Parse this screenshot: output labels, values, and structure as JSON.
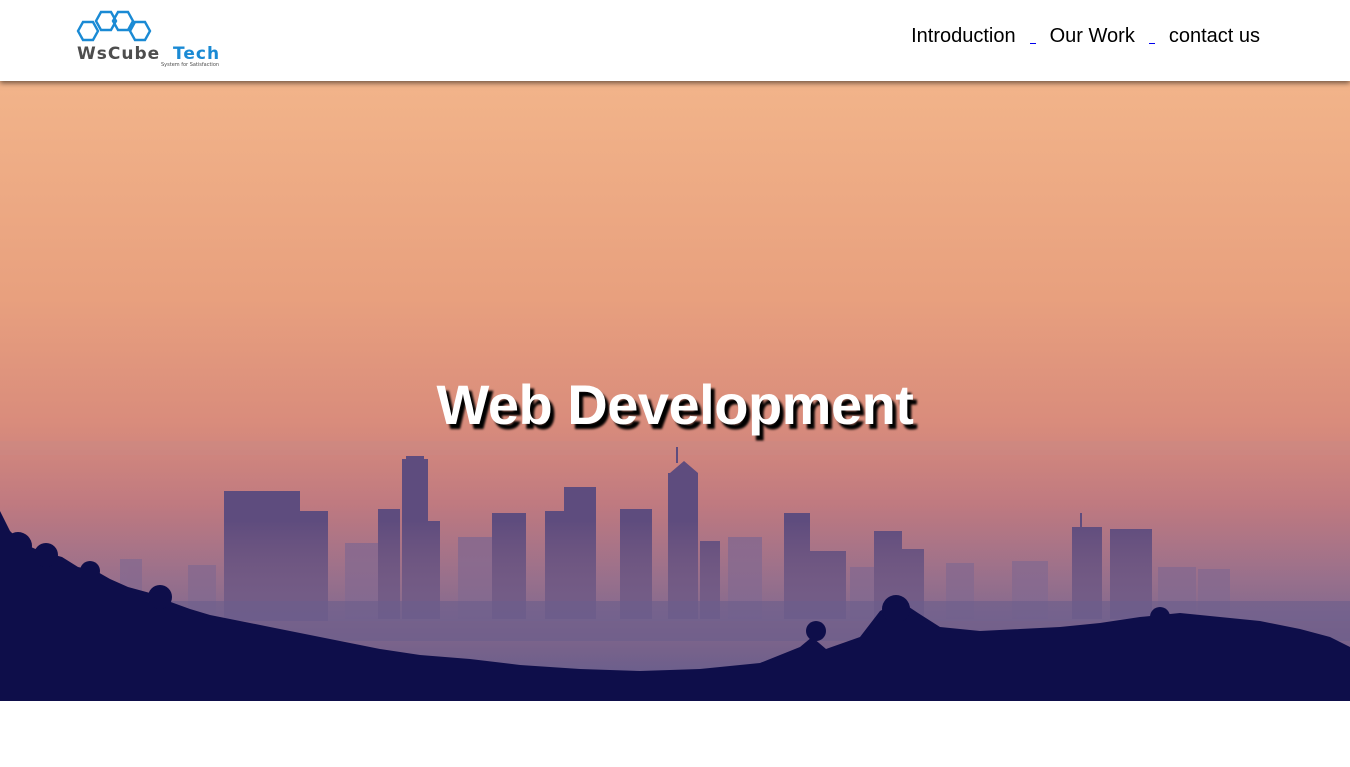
{
  "brand": {
    "name_part1": "WsCube",
    "name_part2": "Tech",
    "tagline": "System for Satisfaction",
    "primary_color": "#1a8ad4",
    "text_color": "#4d4d4d"
  },
  "nav": {
    "items": [
      {
        "label": "Introduction"
      },
      {
        "label": "Our Work"
      },
      {
        "label": "contact us"
      }
    ]
  },
  "hero": {
    "title": "Web Development",
    "sky_top_color": "#f0b48a",
    "sky_mid_color": "#d98a7a",
    "city_color": "#5a4a80",
    "hills_color": "#0e0e4a"
  }
}
